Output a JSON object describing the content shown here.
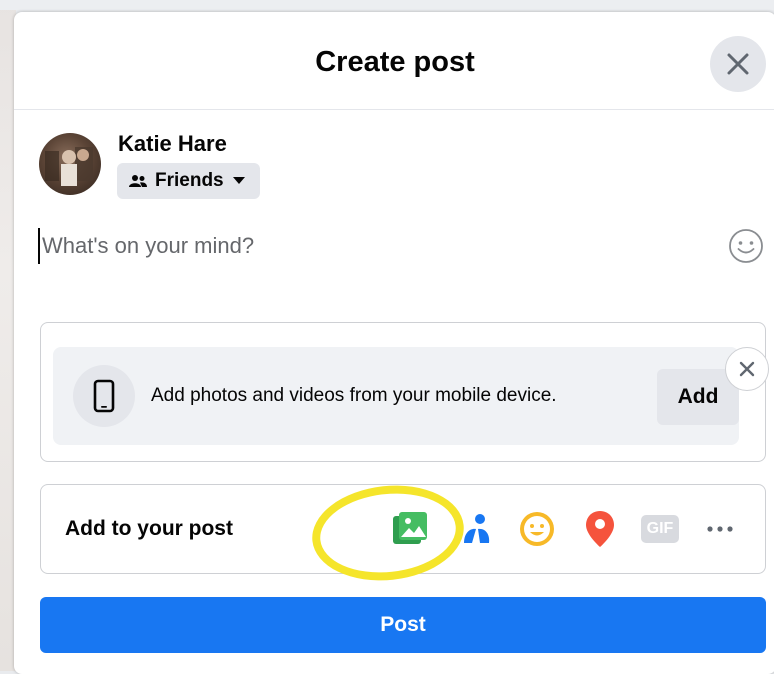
{
  "dialog": {
    "title": "Create post",
    "close_icon": "close-icon"
  },
  "user": {
    "name": "Katie Hare",
    "audience_label": "Friends",
    "audience_icon": "friends-icon"
  },
  "composer": {
    "placeholder": "What's on your mind?",
    "emoji_icon": "smiley-icon"
  },
  "mobile_upload": {
    "text": "Add photos and videos from your mobile device.",
    "add_label": "Add",
    "icon": "mobile-phone-icon"
  },
  "add_to_post": {
    "label": "Add to your post",
    "icons": [
      "photo-video-icon",
      "tag-people-icon",
      "feeling-icon",
      "location-icon",
      "gif-icon",
      "more-icon"
    ],
    "gif_label": "GIF"
  },
  "post_button": {
    "label": "Post"
  },
  "colors": {
    "primary": "#1877f2",
    "photo_green": "#45bd62",
    "tag_blue": "#1877f2",
    "feeling_yellow": "#f7b928",
    "location_red": "#f5533d",
    "highlight_yellow": "#f5e52b"
  }
}
